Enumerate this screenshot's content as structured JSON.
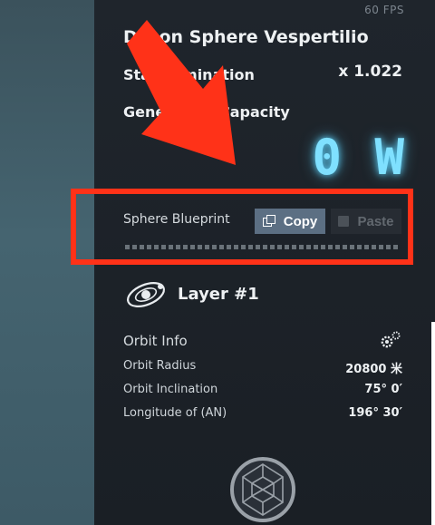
{
  "hud": {
    "fps": "60 FPS"
  },
  "sphere": {
    "title": "Dyson Sphere Vespertilio",
    "rows": [
      {
        "label": "Star Lumination",
        "value": "x 1.022"
      },
      {
        "label": "Generation Capacity",
        "value": ""
      }
    ],
    "power": "0 W"
  },
  "blueprint": {
    "label": "Sphere Blueprint",
    "copy_label": "Copy",
    "paste_label": "Paste"
  },
  "layer": {
    "title": "Layer #1",
    "orbit_header": "Orbit Info",
    "orbit": [
      {
        "label": "Orbit Radius",
        "value": "20800 米"
      },
      {
        "label": "Orbit Inclination",
        "value": "75° 0′"
      },
      {
        "label": "Longitude of (AN)",
        "value": "196° 30′"
      }
    ]
  },
  "colors": {
    "annotation": "#ff3218",
    "power_glow": "#7fe0ff",
    "copy_button": "#5c6f83"
  },
  "icons": [
    "copy-icon",
    "paste-icon",
    "layer-orbit-icon",
    "gear-icon",
    "dyson-sphere-icon"
  ]
}
